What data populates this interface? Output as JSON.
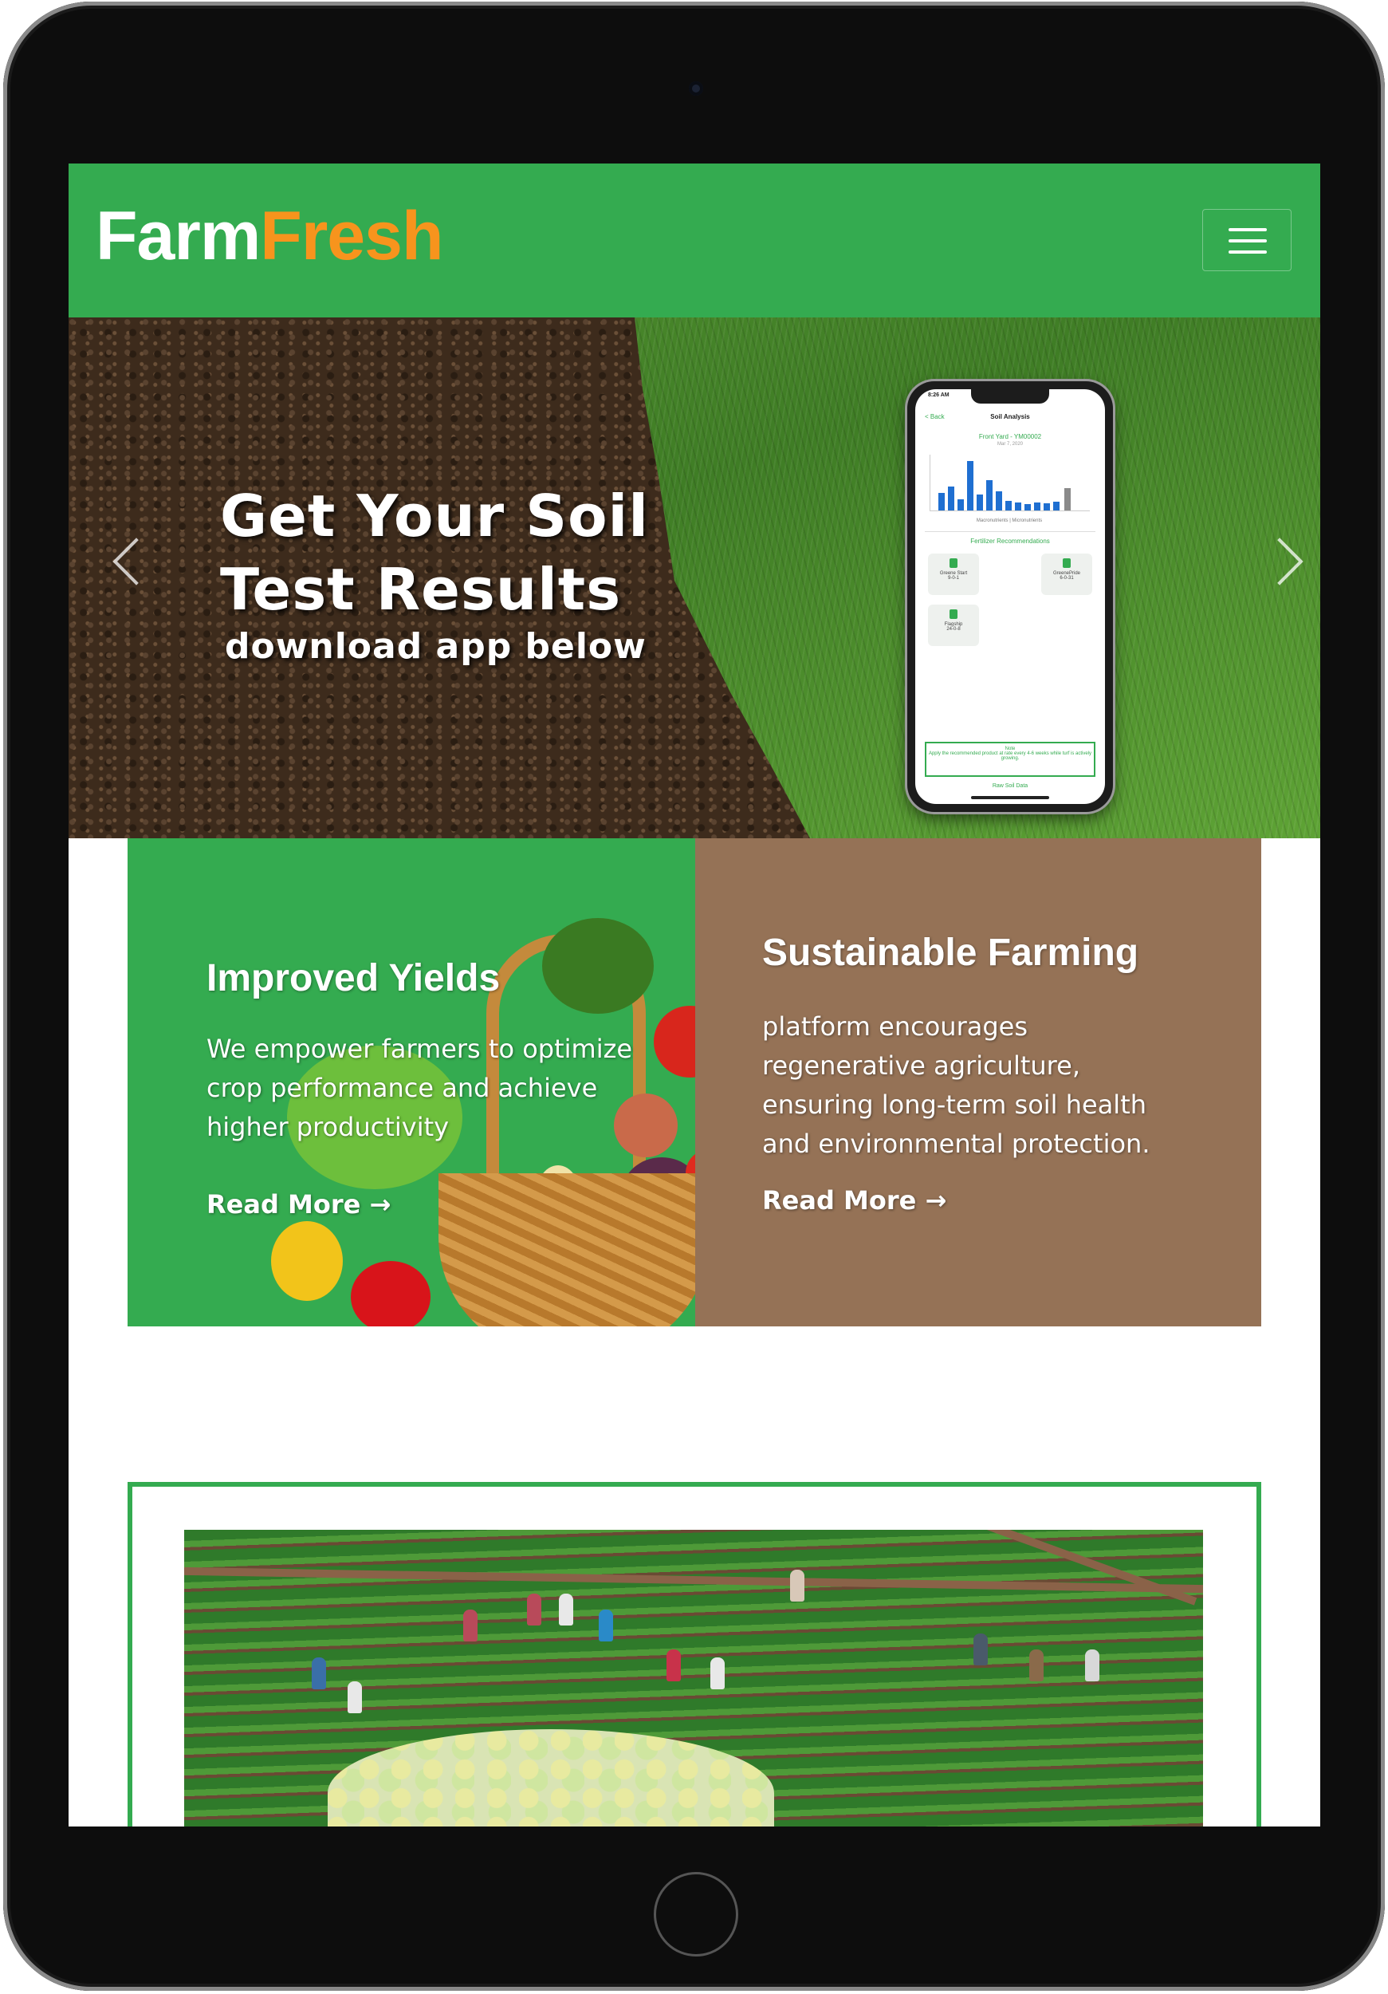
{
  "brand": {
    "part1": "Farm",
    "part2": "Fresh",
    "color_main": "#ffffff",
    "color_accent": "#f7941d"
  },
  "colors": {
    "primary_green": "#34ab50",
    "brown": "#957256"
  },
  "navbar": {
    "menu_icon": "hamburger-icon"
  },
  "hero": {
    "line1": "Get Your Soil",
    "line2": "Test Results",
    "line3": "download app below",
    "prev_icon": "chevron-left-icon",
    "next_icon": "chevron-right-icon"
  },
  "phone": {
    "time": "8:26 AM",
    "back": "< Back",
    "title": "Soil Analysis",
    "subtitle": "Front Yard - YM00002",
    "date": "Mar 7, 2020",
    "axis": "Macronutrients  |  Micronutrients",
    "recommendations": "Fertilizer Recommendations",
    "cards": [
      "Greene Start",
      "GreenePride",
      "Flagship"
    ],
    "card_values": [
      "9-0-1",
      "6-0-31",
      "24-0-8"
    ],
    "note_title": "Note",
    "note_text": "Apply the recommended product at rate every 4-6 weeks while turf is actively growing.",
    "raw_link": "Raw Soil Data"
  },
  "features": [
    {
      "title": "Improved Yields",
      "text": "We empower farmers to optimize crop performance and achieve higher productivity",
      "link": "Read More",
      "link_icon": "arrow-right-icon"
    },
    {
      "title": "Sustainable Farming",
      "text": "platform encourages regenerative agriculture, ensuring long-term soil health and environmental protection.",
      "link": "Read More",
      "link_icon": "arrow-right-icon"
    }
  ]
}
